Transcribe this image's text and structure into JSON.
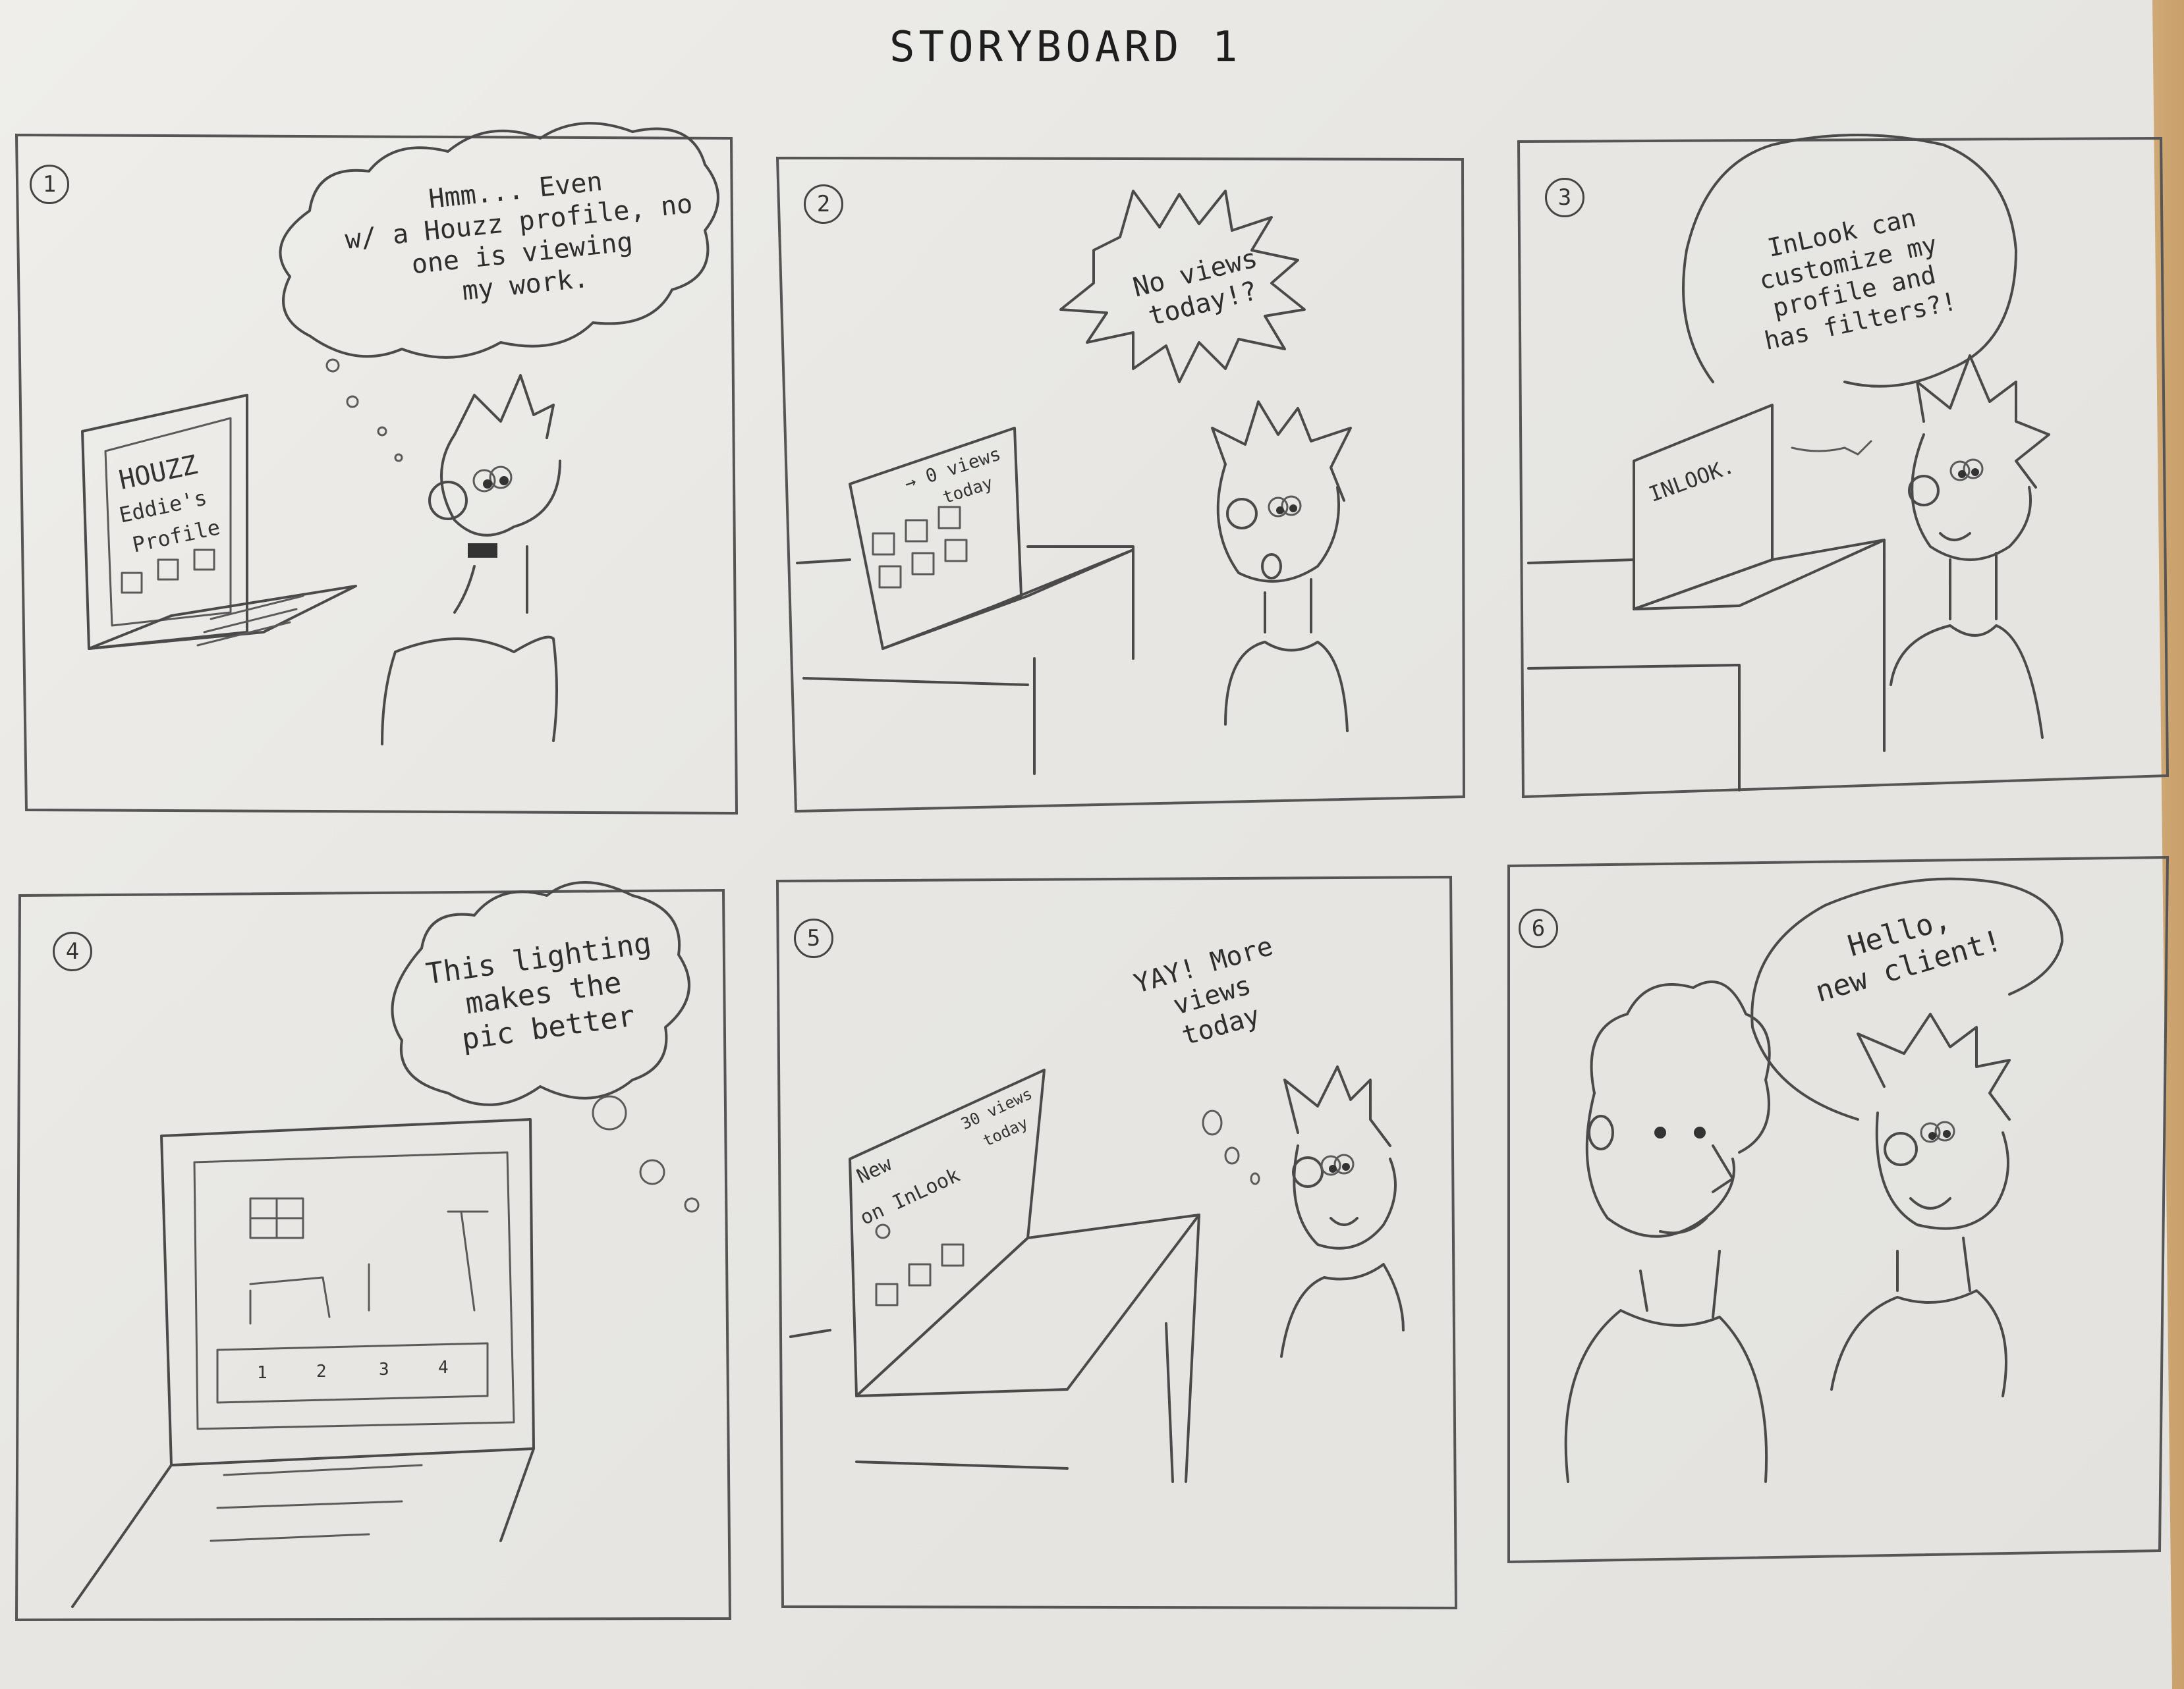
{
  "title": "STORYBOARD 1",
  "panels": [
    {
      "number": "1",
      "bubble_type": "thought",
      "speech": "Hmm... Even\nw/ a Houzz profile, no\none is viewing\nmy work.",
      "screen": [
        "HOUZZ",
        "Eddie's",
        "Profile"
      ]
    },
    {
      "number": "2",
      "bubble_type": "exclamation",
      "speech": "No views\ntoday!?",
      "screen": [
        "→ 0 views",
        "today"
      ]
    },
    {
      "number": "3",
      "bubble_type": "speech",
      "speech": "InLook can\ncustomize my\nprofile and\nhas filters?!",
      "screen": [
        "INLOOK."
      ]
    },
    {
      "number": "4",
      "bubble_type": "thought",
      "speech": "This lighting\nmakes the\npic better",
      "screen": [
        "1",
        "2",
        "3",
        "4"
      ]
    },
    {
      "number": "5",
      "bubble_type": "thought",
      "speech": "YAY! More\nviews\ntoday",
      "screen": [
        "New",
        "on InLook",
        "30 views",
        "today"
      ]
    },
    {
      "number": "6",
      "bubble_type": "speech",
      "speech": "Hello,\nnew client!",
      "screen": []
    }
  ],
  "icons": {
    "character": "spiky-hair-person-icon",
    "client": "curly-hair-person-icon",
    "device": "laptop-icon"
  }
}
